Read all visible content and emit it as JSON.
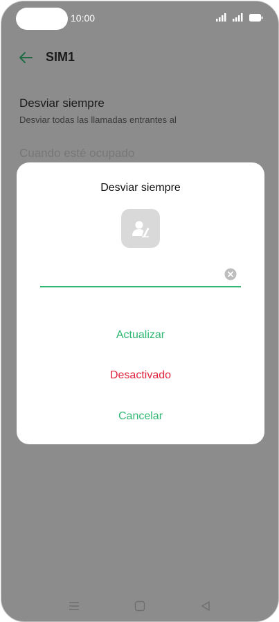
{
  "status_bar": {
    "time": "10:00"
  },
  "header": {
    "title": "SIM1"
  },
  "settings": {
    "always_forward": {
      "title": "Desviar siempre",
      "subtitle": "Desviar todas las llamadas entrantes al"
    },
    "when_busy": {
      "title": "Cuando esté ocupado"
    }
  },
  "dialog": {
    "title": "Desviar siempre",
    "number_value": "",
    "actions": {
      "update": "Actualizar",
      "disable": "Desactivado",
      "cancel": "Cancelar"
    }
  },
  "colors": {
    "accent": "#2eb872",
    "danger": "#e0243f",
    "scrim": "#8c8c8c"
  },
  "icons": {
    "back": "back-arrow-icon",
    "contact": "contact-icon",
    "clear": "clear-icon",
    "nav_menu": "menu-icon",
    "nav_home": "home-icon",
    "nav_back": "back-triangle-icon"
  }
}
